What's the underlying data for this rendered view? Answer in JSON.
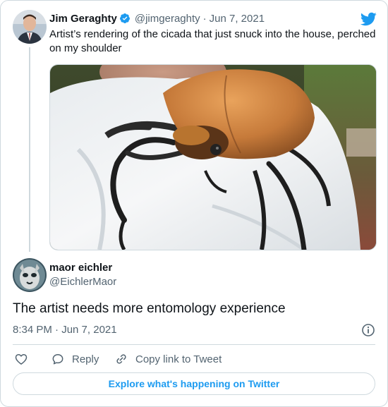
{
  "original_tweet": {
    "author_name": "Jim Geraghty",
    "handle": "@jimgeraghty",
    "separator": "·",
    "date": "Jun 7, 2021",
    "text": "Artist’s rendering of the cicada that just snuck into the house, perched on my shoulder"
  },
  "reply_tweet": {
    "author_name": "maor eichler",
    "handle": "@EichlerMaor",
    "text": "The artist needs more entomology experience",
    "timestamp": "8:34 PM · Jun 7, 2021"
  },
  "actions": {
    "reply_label": "Reply",
    "copy_link_label": "Copy link to Tweet"
  },
  "explore_button": "Explore what's happening on Twitter",
  "colors": {
    "accent": "#1d9bf0",
    "text": "#0f1419",
    "muted": "#536471",
    "border": "#cfd9de"
  },
  "icons": [
    "twitter-bird-icon",
    "verified-badge-icon",
    "heart-icon",
    "reply-icon",
    "link-icon",
    "info-icon"
  ]
}
